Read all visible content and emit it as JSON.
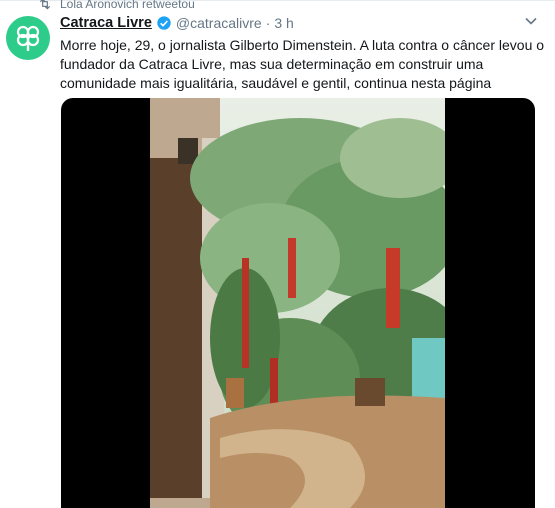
{
  "retweet": {
    "text": "Lola Aronovich retweetou",
    "icon": "retweet-icon"
  },
  "tweet": {
    "name": "Catraca Livre",
    "handle": "@catracalivre",
    "separator": "·",
    "time": "3 h",
    "text": "Morre hoje, 29, o jornalista Gilberto Dimenstein. A luta contra o câncer levou o fundador da Catraca Livre, mas sua determinação em construir uma comunidade mais igualitária, saudável e gentil, continua nesta página",
    "avatar_color": "#2ecc8a",
    "verified_color": "#1da1f2"
  },
  "media": {
    "type": "video",
    "description_icon": "video-player"
  }
}
